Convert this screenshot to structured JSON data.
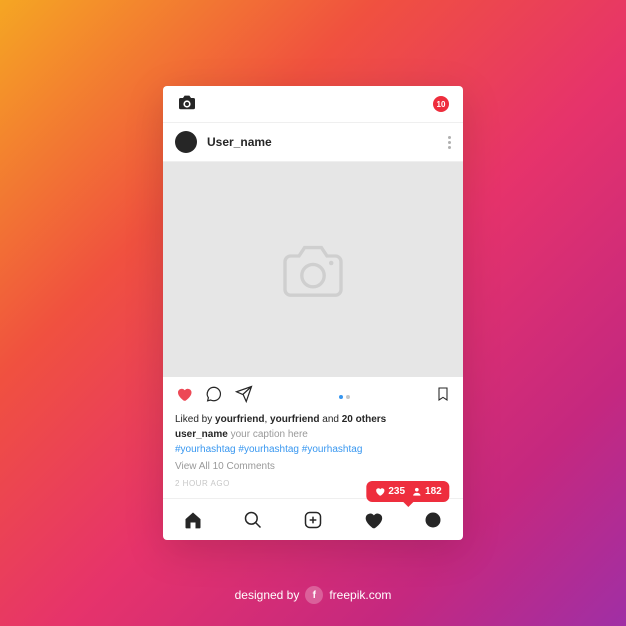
{
  "topbar": {
    "notification_count": "10"
  },
  "post": {
    "username": "User_name",
    "liked_by_prefix": "Liked by ",
    "liked_by_friend1": "yourfriend",
    "liked_by_sep": ", ",
    "liked_by_friend2": "yourfriend",
    "liked_by_and": " and ",
    "liked_by_count": "20 others",
    "caption_user": "user_name",
    "caption_text": " your caption here",
    "hashtag1": "#yourhashtag",
    "hashtag2": "#yourhashtag",
    "hashtag3": "#yourhashtag",
    "view_all": "View All 10 Comments",
    "timestamp": "2 HOUR AGO"
  },
  "activity_popup": {
    "likes": "235",
    "followers": "182"
  },
  "footer": {
    "prefix": "designed by",
    "brand": "freepik.com"
  }
}
